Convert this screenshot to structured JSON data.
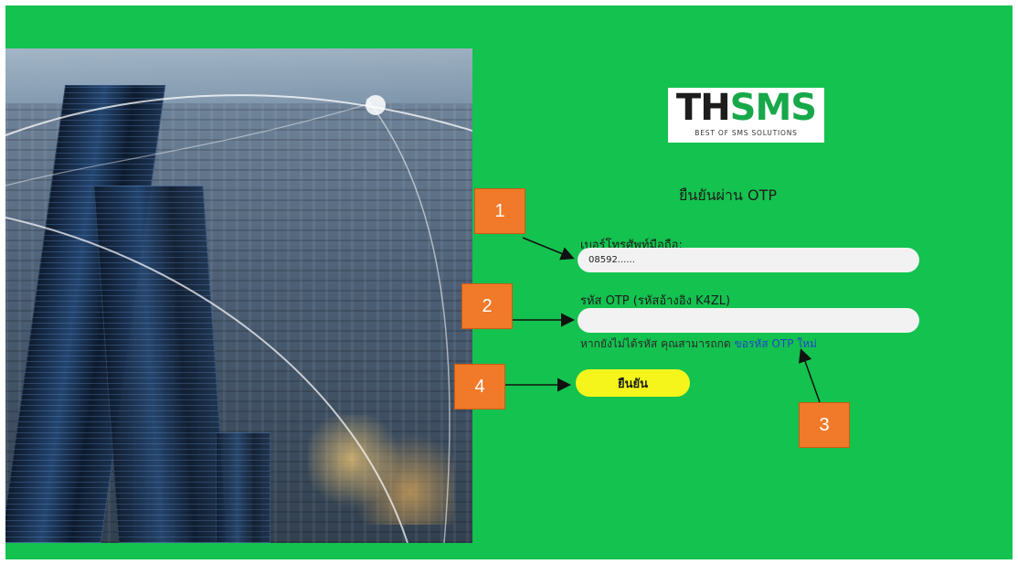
{
  "brand": {
    "name_part1": "TH",
    "name_part2": "SMS",
    "tagline": "BEST OF SMS SOLUTIONS"
  },
  "form": {
    "title": "ยืนยันผ่าน OTP",
    "phone_label": "เบอร์โทรศัพท์มือถือ:",
    "phone_value": "08592......",
    "otp_label": "รหัส OTP (รหัสอ้างอิง K4ZL)",
    "otp_value": "",
    "hint_text": "หากยังไม่ได้รหัส คุณสามารถกด ",
    "resend_link": "ขอรหัส OTP ใหม่",
    "confirm_label": "ยืนยัน"
  },
  "annotations": {
    "callout_1": "1",
    "callout_2": "2",
    "callout_3": "3",
    "callout_4": "4"
  },
  "colors": {
    "background_green": "#14c24f",
    "confirm_button": "#f5f51c",
    "callout_orange": "#f07a2a",
    "link_blue": "#2246c9"
  }
}
